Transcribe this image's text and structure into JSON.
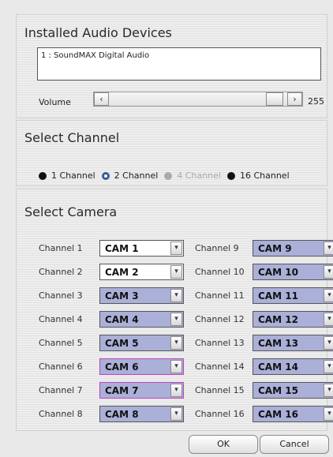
{
  "audio": {
    "title": "Installed Audio Devices",
    "device": "1 : SoundMAX Digital Audio",
    "volume_label": "Volume",
    "volume_value": "255",
    "volume_level": 0.93
  },
  "channel": {
    "title": "Select Channel",
    "options": [
      "1 Channel",
      "2 Channel",
      "4 Channel",
      "16 Channel"
    ],
    "selected": "2 Channel",
    "disabled": "4 Channel"
  },
  "camera": {
    "title": "Select Camera",
    "left": [
      {
        "label": "Channel 1",
        "value": "CAM 1"
      },
      {
        "label": "Channel 2",
        "value": "CAM 2"
      },
      {
        "label": "Channel 3",
        "value": "CAM 3"
      },
      {
        "label": "Channel 4",
        "value": "CAM 4"
      },
      {
        "label": "Channel 5",
        "value": "CAM 5"
      },
      {
        "label": "Channel 6",
        "value": "CAM 6"
      },
      {
        "label": "Channel 7",
        "value": "CAM 7"
      },
      {
        "label": "Channel 8",
        "value": "CAM 8"
      }
    ],
    "right": [
      {
        "label": "Channel 9",
        "value": "CAM 9"
      },
      {
        "label": "Channel 10",
        "value": "CAM 10"
      },
      {
        "label": "Channel 11",
        "value": "CAM 11"
      },
      {
        "label": "Channel 12",
        "value": "CAM 12"
      },
      {
        "label": "Channel 13",
        "value": "CAM 13"
      },
      {
        "label": "Channel 14",
        "value": "CAM 14"
      },
      {
        "label": "Channel 15",
        "value": "CAM 15"
      },
      {
        "label": "Channel 16",
        "value": "CAM 16"
      }
    ]
  },
  "buttons": {
    "ok": "OK",
    "cancel": "Cancel"
  }
}
